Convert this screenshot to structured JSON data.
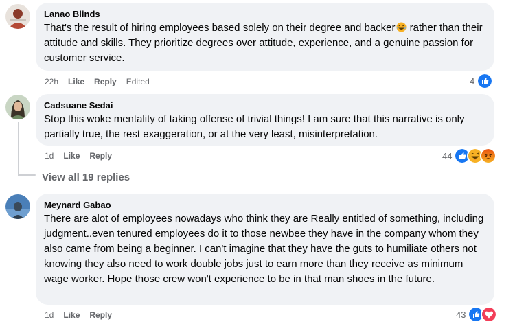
{
  "comments": [
    {
      "author": "Lanao Blinds",
      "text_before_emoji": "That's the result of hiring employees based solely on their degree and backer",
      "emoji": "laughing-emoji",
      "text_after_emoji": " rather than their attitude and skills. They prioritize degrees over attitude, experience, and a genuine passion for customer service.",
      "timestamp": "22h",
      "like_label": "Like",
      "reply_label": "Reply",
      "edited_label": "Edited",
      "reaction_count": "4",
      "reactions": [
        "like"
      ]
    },
    {
      "author": "Cadsuane Sedai",
      "text": "Stop this woke mentality of taking offense of trivial things! I am sure that this narrative is only partially true, the rest exaggeration, or at the very least, misinterpretation.",
      "timestamp": "1d",
      "like_label": "Like",
      "reply_label": "Reply",
      "reaction_count": "44",
      "reactions": [
        "like",
        "haha",
        "angry"
      ]
    },
    {
      "author": "Meynard Gabao",
      "text": "There are alot of employees nowadays who think they are Really entitled of something, including judgment..even tenured employees do it to those newbee they have in the company whom they also came from being a beginner. I can't imagine that they have the guts to humiliate others not knowing they also need to work double jobs just to earn more than they receive as minimum wage worker. Hope those crew won't experience to be in that man shoes in the future.",
      "timestamp": "1d",
      "like_label": "Like",
      "reply_label": "Reply",
      "reaction_count": "43",
      "reactions": [
        "like",
        "love"
      ]
    }
  ],
  "view_replies_label": "View all 19 replies",
  "colors": {
    "bubble": "#f0f2f5",
    "meta_text": "#65676b",
    "like_blue": "#1877f2",
    "love_red": "#f33e58",
    "haha_yellow": "#f7b125",
    "angry_orange": "#e9710f"
  }
}
